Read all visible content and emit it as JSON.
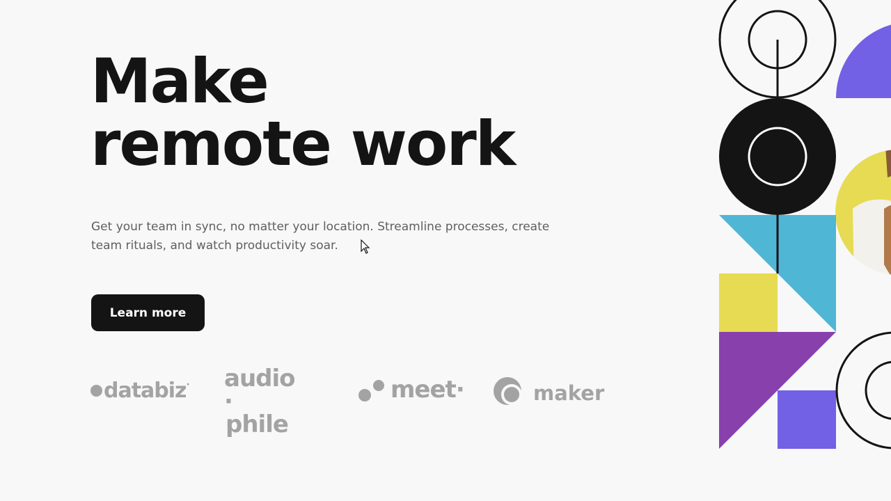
{
  "hero": {
    "headline_line1": "Make",
    "headline_line2": "remote work",
    "description": "Get your team in sync, no matter your location. Streamline processes, create team rituals, and watch productivity soar.",
    "cta_label": "Learn more"
  },
  "clients": {
    "databiz": {
      "name": "databiz",
      "mark": "·"
    },
    "audiophile": {
      "line1": "audio",
      "line2": "phile",
      "mark": "·"
    },
    "meet": {
      "name": "meet",
      "mark": "·"
    },
    "maker": {
      "name": "maker"
    }
  },
  "colors": {
    "text_dark": "#141414",
    "text_muted": "#5f5f5f",
    "logo_gray": "#a3a3a3",
    "background": "#f8f8f8",
    "purple": "#7260e5",
    "violet": "#8840ad",
    "cyan": "#4fb6d6",
    "yellow": "#e6db52"
  },
  "icons": {
    "illustration": "geometric-pattern-with-photo",
    "cursor": "mouse-pointer-icon"
  }
}
